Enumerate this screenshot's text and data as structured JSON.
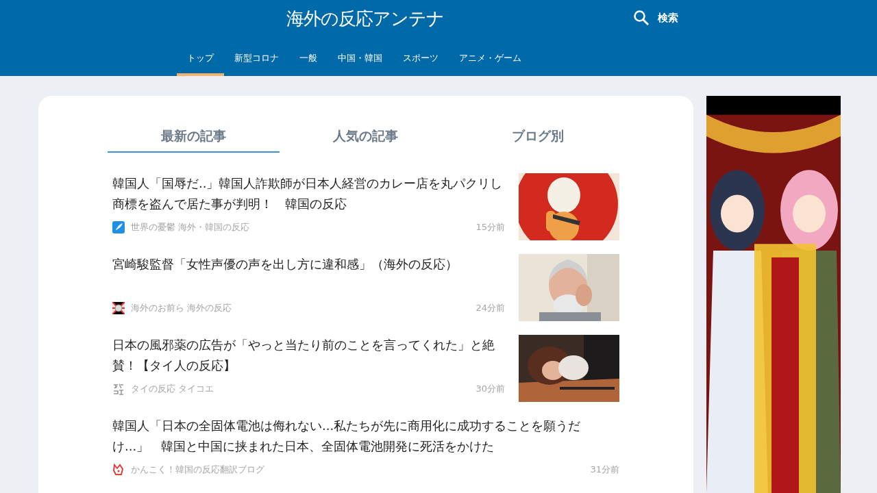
{
  "header": {
    "logo": "海外の反応アンテナ",
    "search_label": "検索"
  },
  "nav": [
    {
      "label": "トップ",
      "selected": true
    },
    {
      "label": "新型コロナ",
      "selected": false
    },
    {
      "label": "一般",
      "selected": false
    },
    {
      "label": "中国・韓国",
      "selected": false
    },
    {
      "label": "スポーツ",
      "selected": false
    },
    {
      "label": "アニメ・ゲーム",
      "selected": false
    }
  ],
  "tabs": [
    {
      "label": "最新の記事",
      "selected": true
    },
    {
      "label": "人気の記事",
      "selected": false
    },
    {
      "label": "ブログ別",
      "selected": false
    }
  ],
  "articles": [
    {
      "title": "韓国人「国辱だ..」韓国人詐欺師が日本人経営のカレー店を丸パクリし商標を盗んで居た事が判明！　韓国の反応",
      "source": "世界の憂鬱 海外・韓国の反応",
      "source_icon": {
        "kind": "feather"
      },
      "time": "15分前"
    },
    {
      "title": "宮崎駿監督「女性声優の声を出し方に違和感」（海外の反応）",
      "source": "海外のお前ら 海外の反応",
      "source_icon": {
        "kind": "burst"
      },
      "time": "24分前"
    },
    {
      "title": "日本の風邪薬の広告が「やっと当たり前のことを言ってくれた」と絶賛！【タイ人の反応】",
      "source": "タイの反応 タイコエ",
      "source_icon": {
        "kind": "marks"
      },
      "time": "30分前"
    },
    {
      "title": "韓国人「日本の全固体電池は侮れない...私たちが先に商用化に成功することを願うだけ...」　韓国と中国に挟まれた日本、全固体電池開発に死活をかけた",
      "source": "かんこく！韓国の反応翻訳ブログ",
      "source_icon": {
        "kind": "fox"
      },
      "time": "31分前"
    }
  ]
}
